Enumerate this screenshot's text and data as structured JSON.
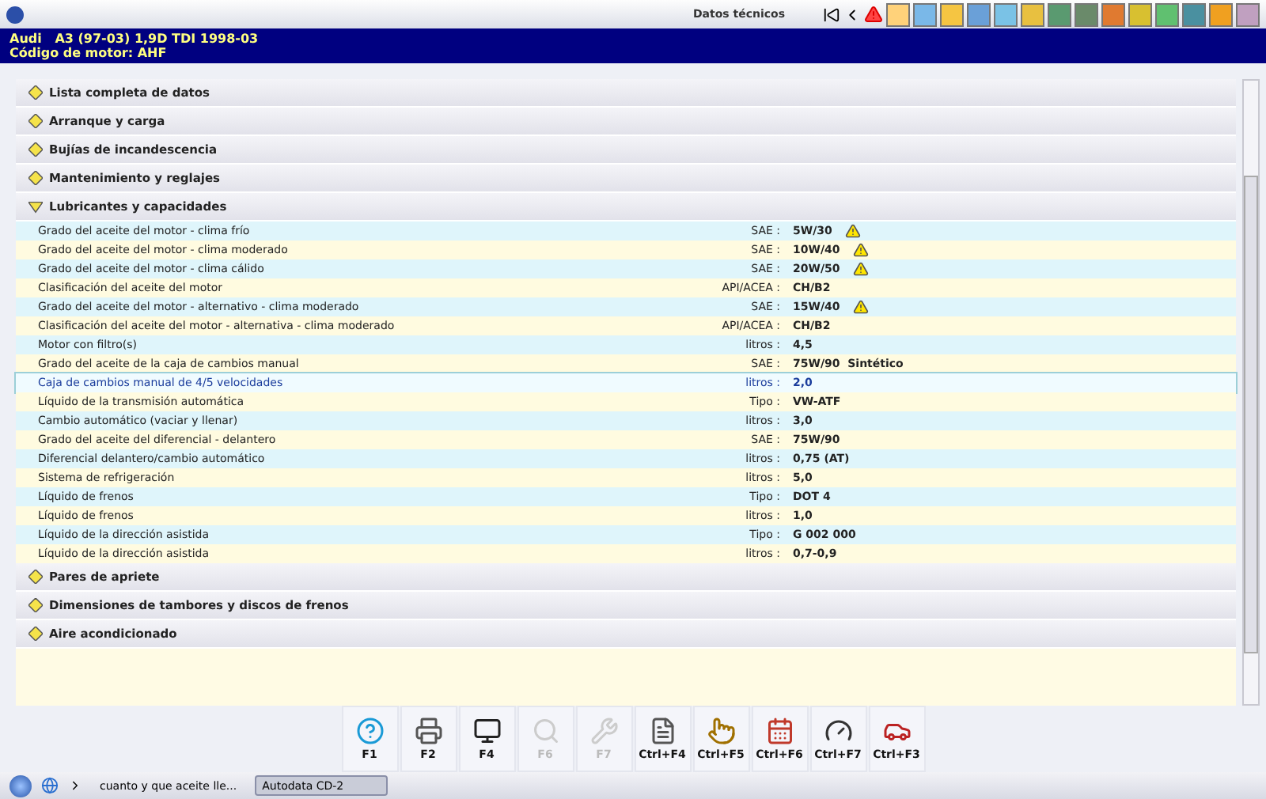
{
  "window": {
    "title": "Datos técnicos"
  },
  "vehicle": {
    "model": "Audi   A3 (97-03) 1,9D TDI 1998-03",
    "engine": "Código de motor: AHF"
  },
  "sections": [
    {
      "title": "Lista completa de datos",
      "expanded": false
    },
    {
      "title": "Arranque y carga",
      "expanded": false
    },
    {
      "title": "Bujías de incandescencia",
      "expanded": false
    },
    {
      "title": "Mantenimiento y reglajes",
      "expanded": false
    },
    {
      "title": "Lubricantes y capacidades",
      "expanded": true,
      "rows": [
        {
          "label": "Grado del aceite del motor - clima frío",
          "unit": "SAE :",
          "value": "5W/30",
          "warning": true,
          "selected": false
        },
        {
          "label": "Grado del aceite del motor - clima moderado",
          "unit": "SAE :",
          "value": "10W/40",
          "warning": true,
          "selected": false
        },
        {
          "label": "Grado del aceite del motor - clima cálido",
          "unit": "SAE :",
          "value": "20W/50",
          "warning": true,
          "selected": false
        },
        {
          "label": "Clasificación del aceite del motor",
          "unit": "API/ACEA :",
          "value": "CH/B2",
          "warning": false,
          "selected": false
        },
        {
          "label": "Grado del aceite del motor - alternativo - clima moderado",
          "unit": "SAE :",
          "value": "15W/40",
          "warning": true,
          "selected": false
        },
        {
          "label": "Clasificación del aceite del motor - alternativa - clima moderado",
          "unit": "API/ACEA :",
          "value": "CH/B2",
          "warning": false,
          "selected": false
        },
        {
          "label": "Motor con filtro(s)",
          "unit": "litros :",
          "value": "4,5",
          "warning": false,
          "selected": false
        },
        {
          "label": "Grado del aceite de la caja de cambios manual",
          "unit": "SAE :",
          "value": "75W/90  Sintético",
          "warning": false,
          "selected": false
        },
        {
          "label": "Caja de cambios manual de 4/5 velocidades",
          "unit": "litros :",
          "value": "2,0",
          "warning": false,
          "selected": true
        },
        {
          "label": "Líquido de la transmisión automática",
          "unit": "Tipo :",
          "value": "VW-ATF",
          "warning": false,
          "selected": false
        },
        {
          "label": "Cambio automático (vaciar y llenar)",
          "unit": "litros :",
          "value": "3,0",
          "warning": false,
          "selected": false
        },
        {
          "label": "Grado del aceite del diferencial - delantero",
          "unit": "SAE :",
          "value": "75W/90",
          "warning": false,
          "selected": false
        },
        {
          "label": "Diferencial delantero/cambio automático",
          "unit": "litros :",
          "value": "0,75 (AT)",
          "warning": false,
          "selected": false
        },
        {
          "label": "Sistema de refrigeración",
          "unit": "litros :",
          "value": "5,0",
          "warning": false,
          "selected": false
        },
        {
          "label": "Líquido de frenos",
          "unit": "Tipo :",
          "value": "DOT 4",
          "warning": false,
          "selected": false
        },
        {
          "label": "Líquido de frenos",
          "unit": "litros :",
          "value": "1,0",
          "warning": false,
          "selected": false
        },
        {
          "label": "Líquido de la dirección asistida",
          "unit": "Tipo :",
          "value": "G 002 000",
          "warning": false,
          "selected": false
        },
        {
          "label": "Líquido de la dirección asistida",
          "unit": "litros :",
          "value": "0,7-0,9",
          "warning": false,
          "selected": false
        }
      ]
    },
    {
      "title": "Pares de apriete",
      "expanded": false
    },
    {
      "title": "Dimensiones de tambores y discos de frenos",
      "expanded": false
    },
    {
      "title": "Aire acondicionado",
      "expanded": false
    }
  ],
  "function_keys": [
    {
      "label": "F1",
      "kind": "help",
      "disabled": false
    },
    {
      "label": "F2",
      "kind": "print",
      "disabled": false
    },
    {
      "label": "F4",
      "kind": "screen",
      "disabled": false
    },
    {
      "label": "F6",
      "kind": "search",
      "disabled": true
    },
    {
      "label": "F7",
      "kind": "tool",
      "disabled": true
    },
    {
      "label": "Ctrl+F4",
      "kind": "note",
      "disabled": false
    },
    {
      "label": "Ctrl+F5",
      "kind": "pointer",
      "disabled": false
    },
    {
      "label": "Ctrl+F6",
      "kind": "calendar",
      "disabled": false
    },
    {
      "label": "Ctrl+F7",
      "kind": "gauge",
      "disabled": false
    },
    {
      "label": "Ctrl+F3",
      "kind": "lift",
      "disabled": false
    }
  ],
  "taskbar": {
    "tasks": [
      {
        "label": "cuanto y que aceite lle...",
        "selected": false
      },
      {
        "label": "Autodata CD-2",
        "selected": true
      }
    ]
  }
}
